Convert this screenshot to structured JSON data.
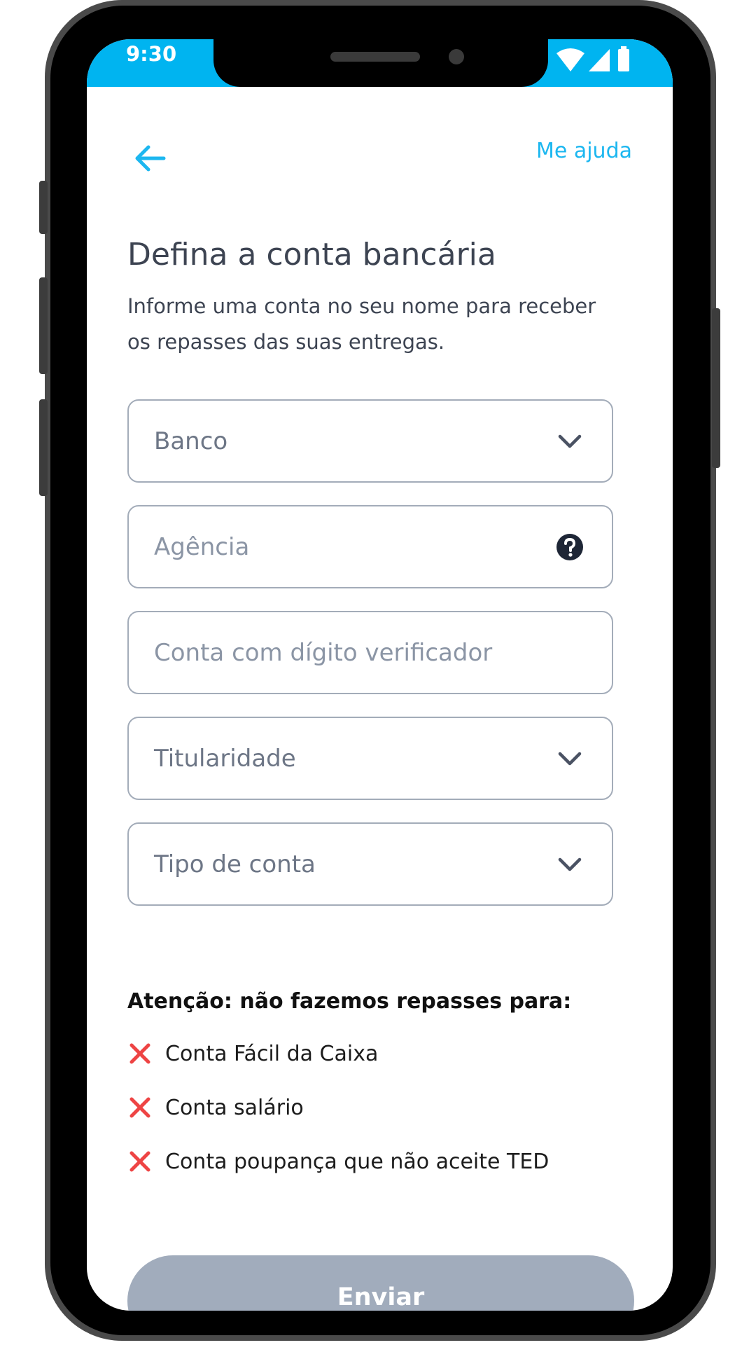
{
  "status_bar": {
    "time": "9:30"
  },
  "header": {
    "help_label": "Me ajuda"
  },
  "title": "Defina a conta bancária",
  "subtitle_lines": [
    "Informe uma conta no seu nome para receber",
    "os repasses das suas entregas."
  ],
  "fields": {
    "bank": {
      "label": "Banco"
    },
    "agency": {
      "label": "Agência"
    },
    "account": {
      "label": "Conta com dígito verificador"
    },
    "ownership": {
      "label": "Titularidade"
    },
    "account_type": {
      "label": "Tipo de conta"
    }
  },
  "warning": {
    "title": "Atenção: não fazemos repasses para:",
    "items": [
      "Conta Fácil da Caixa",
      "Conta salário",
      "Conta poupança que não aceite TED"
    ]
  },
  "submit_label": "Enviar",
  "colors": {
    "accent": "#1cb7f0",
    "status_bar": "#00b4f0",
    "error_x": "#ee4444",
    "button_disabled": "#a1acbc"
  }
}
